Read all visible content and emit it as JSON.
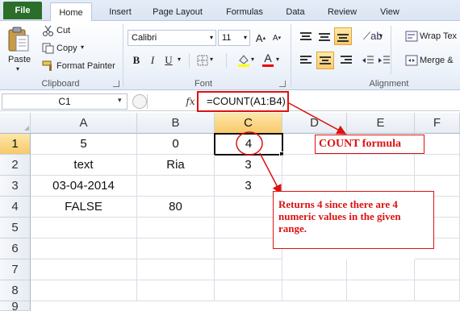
{
  "tabs": [
    "File",
    "Home",
    "Insert",
    "Page Layout",
    "Formulas",
    "Data",
    "Review",
    "View"
  ],
  "ribbon": {
    "clipboard": {
      "paste": "Paste",
      "cut": "Cut",
      "copy": "Copy",
      "format_painter": "Format Painter",
      "label": "Clipboard"
    },
    "font": {
      "name": "Calibri",
      "size": "11",
      "grow": "A",
      "shrink": "A",
      "bold": "B",
      "italic": "I",
      "underline": "U",
      "fill_letter": "A",
      "font_color_letter": "A",
      "label": "Font"
    },
    "alignment": {
      "wrap_text": "Wrap Tex",
      "merge": "Merge &",
      "label": "Alignment"
    }
  },
  "formula_bar": {
    "name_box": "C1",
    "fx": "fx",
    "formula": "=COUNT(A1:B4)"
  },
  "columns": [
    "A",
    "B",
    "C",
    "D",
    "E",
    "F"
  ],
  "rows": [
    "1",
    "2",
    "3",
    "4",
    "5",
    "6",
    "7",
    "8",
    "9"
  ],
  "cells": {
    "A1": "5",
    "B1": "0",
    "C1": "4",
    "A2": "text",
    "B2": "Ria",
    "C2": "3",
    "A3": "03-04-2014",
    "C3": "3",
    "A4": "FALSE",
    "B4": "80"
  },
  "annotations": {
    "count_formula": "COUNT formula",
    "returns": "Returns 4 since there are 4 numeric values in the given range."
  },
  "colors": {
    "file_tab": "#2a6e2a",
    "annotation": "#d11111",
    "selected_header": "#f7c96b"
  }
}
